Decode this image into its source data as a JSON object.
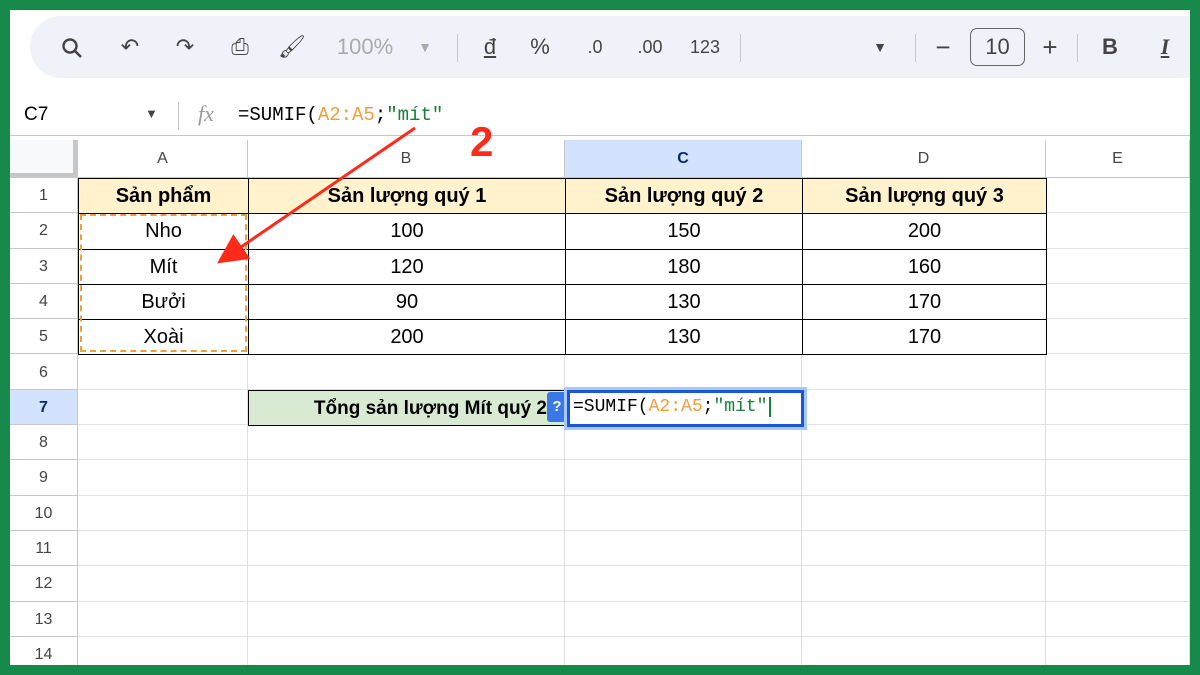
{
  "toolbar": {
    "zoom": "100%",
    "currency": "đ",
    "percent": "%",
    "dec_less": ".0",
    "dec_more": ".00",
    "number_format": "123",
    "font_size": "10",
    "minus": "−",
    "plus": "+",
    "bold": "B",
    "italic": "I"
  },
  "formula_bar": {
    "cell_ref": "C7",
    "fx": "fx",
    "f_prefix": "=SUMIF(",
    "f_range": "A2:A5",
    "f_sep": ";",
    "f_string": "\"mít\""
  },
  "columns": [
    "A",
    "B",
    "C",
    "D",
    "E"
  ],
  "rows": [
    "1",
    "2",
    "3",
    "4",
    "5",
    "6",
    "7",
    "8",
    "9",
    "10",
    "11",
    "12",
    "13",
    "14"
  ],
  "table": {
    "headers": [
      "Sản phẩm",
      "Sản lượng quý 1",
      "Sản lượng quý 2",
      "Sản lượng quý 3"
    ],
    "data": [
      [
        "Nho",
        "100",
        "150",
        "200"
      ],
      [
        "Mít",
        "120",
        "180",
        "160"
      ],
      [
        "Bưởi",
        "90",
        "130",
        "170"
      ],
      [
        "Xoài",
        "200",
        "130",
        "170"
      ]
    ]
  },
  "label_cell": "Tổng sản lượng Mít quý 2",
  "help_badge": "?",
  "annotation": {
    "number": "2",
    "color": "#ff2a1a"
  },
  "colors": {
    "header_fill": "#fff2cc",
    "label_fill": "#d9ead3",
    "selection": "#1a56db",
    "border": "#17894a"
  }
}
